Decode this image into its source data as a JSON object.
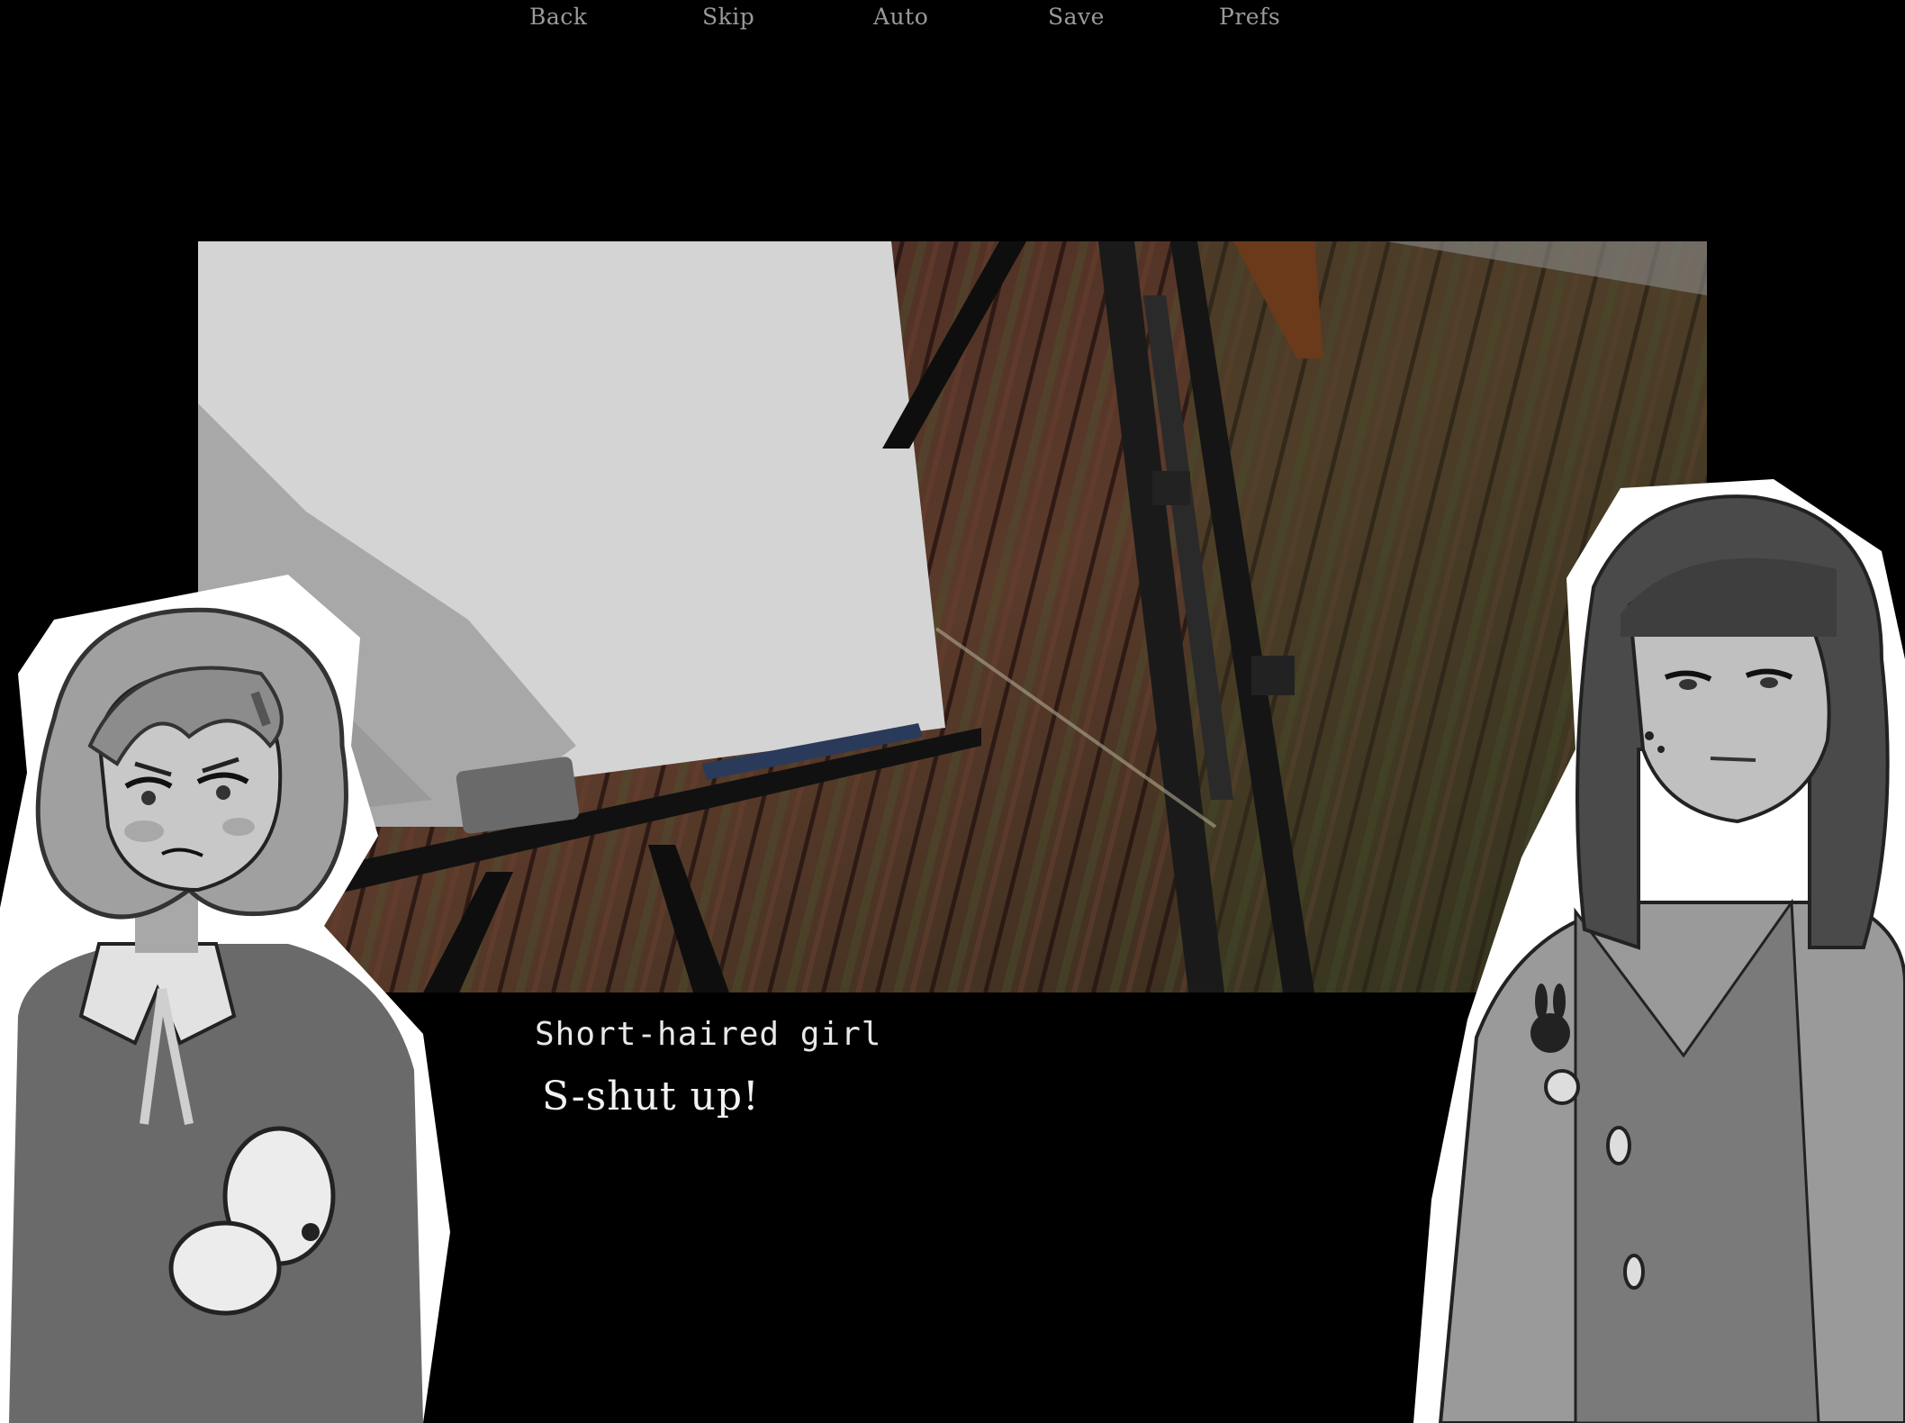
{
  "quick_menu": {
    "back": "Back",
    "skip": "Skip",
    "auto": "Auto",
    "save": "Save",
    "prefs": "Prefs"
  },
  "dialogue": {
    "speaker": "Short-haired girl",
    "line": "S-shut up!"
  },
  "scene": {
    "description_icon": "easel-classroom-background",
    "colors": {
      "canvas": "#d4d4d4",
      "floor_dark": "#3a1f1a",
      "floor_mid": "#5a3428",
      "floor_green": "#3a4524"
    }
  },
  "characters": {
    "left_icon": "short-haired-girl-sprite",
    "right_icon": "long-haired-girl-sprite"
  }
}
